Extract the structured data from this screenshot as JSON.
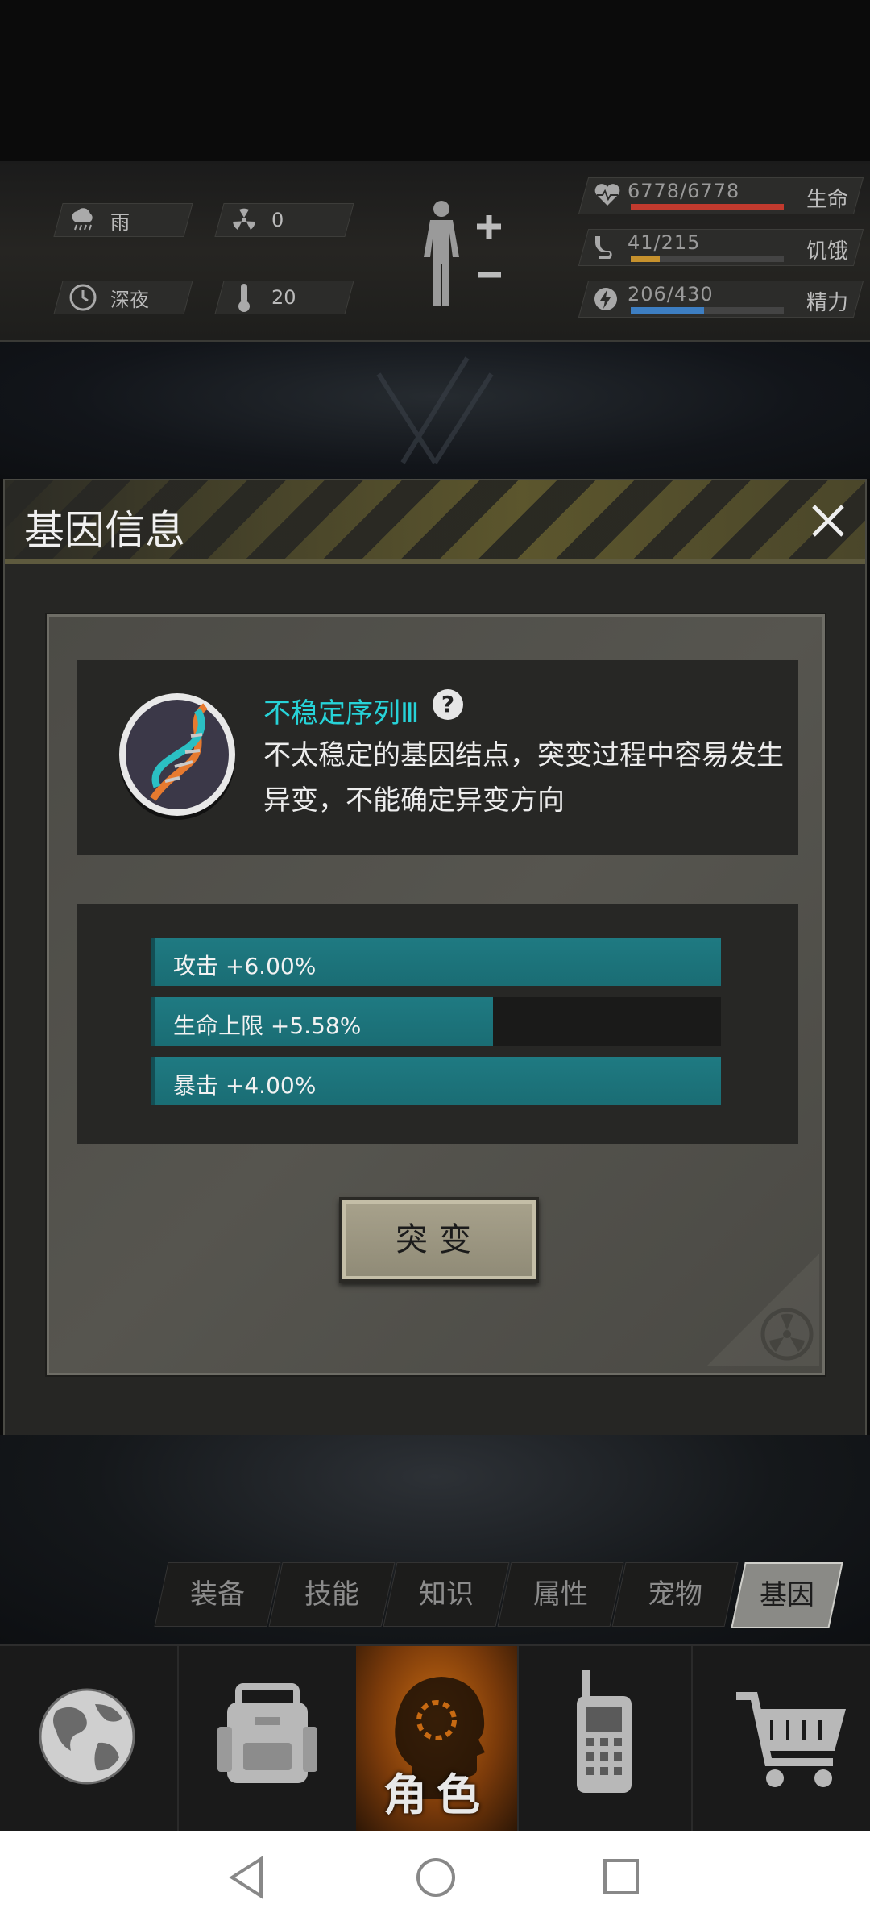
{
  "hud": {
    "weather": "雨",
    "radiation": "0",
    "time": "深夜",
    "temperature": "20",
    "stats": [
      {
        "value": "6778/6778",
        "label": "生命",
        "ratio": 1.0,
        "color": "#c23a2e"
      },
      {
        "value": "41/215",
        "label": "饥饿",
        "ratio": 0.19,
        "color": "#c6912d"
      },
      {
        "value": "206/430",
        "label": "精力",
        "ratio": 0.48,
        "color": "#3d7ec2"
      }
    ]
  },
  "dialog": {
    "title": "基因信息",
    "gene_name": "不稳定序列Ⅲ",
    "help": "?",
    "description": "不太稳定的基因结点，突变过程中容易发生异变，不能确定异变方向",
    "attributes": [
      {
        "text": "攻击 +6.00%",
        "ratio": 1.0
      },
      {
        "text": "生命上限 +5.58%",
        "ratio": 0.6
      },
      {
        "text": "暴击 +4.00%",
        "ratio": 1.0
      }
    ],
    "button": "突变"
  },
  "tabs": [
    "装备",
    "技能",
    "知识",
    "属性",
    "宠物",
    "基因"
  ],
  "active_tab": "基因",
  "bottom_nav": {
    "active_label": "角色",
    "icons": [
      "globe-icon",
      "backpack-icon",
      "character-icon",
      "radio-icon",
      "cart-icon"
    ]
  },
  "colors": {
    "gene_name": "#27d3d8",
    "attr_bar": "#1f7a82",
    "active_nav": "#c86a12"
  }
}
